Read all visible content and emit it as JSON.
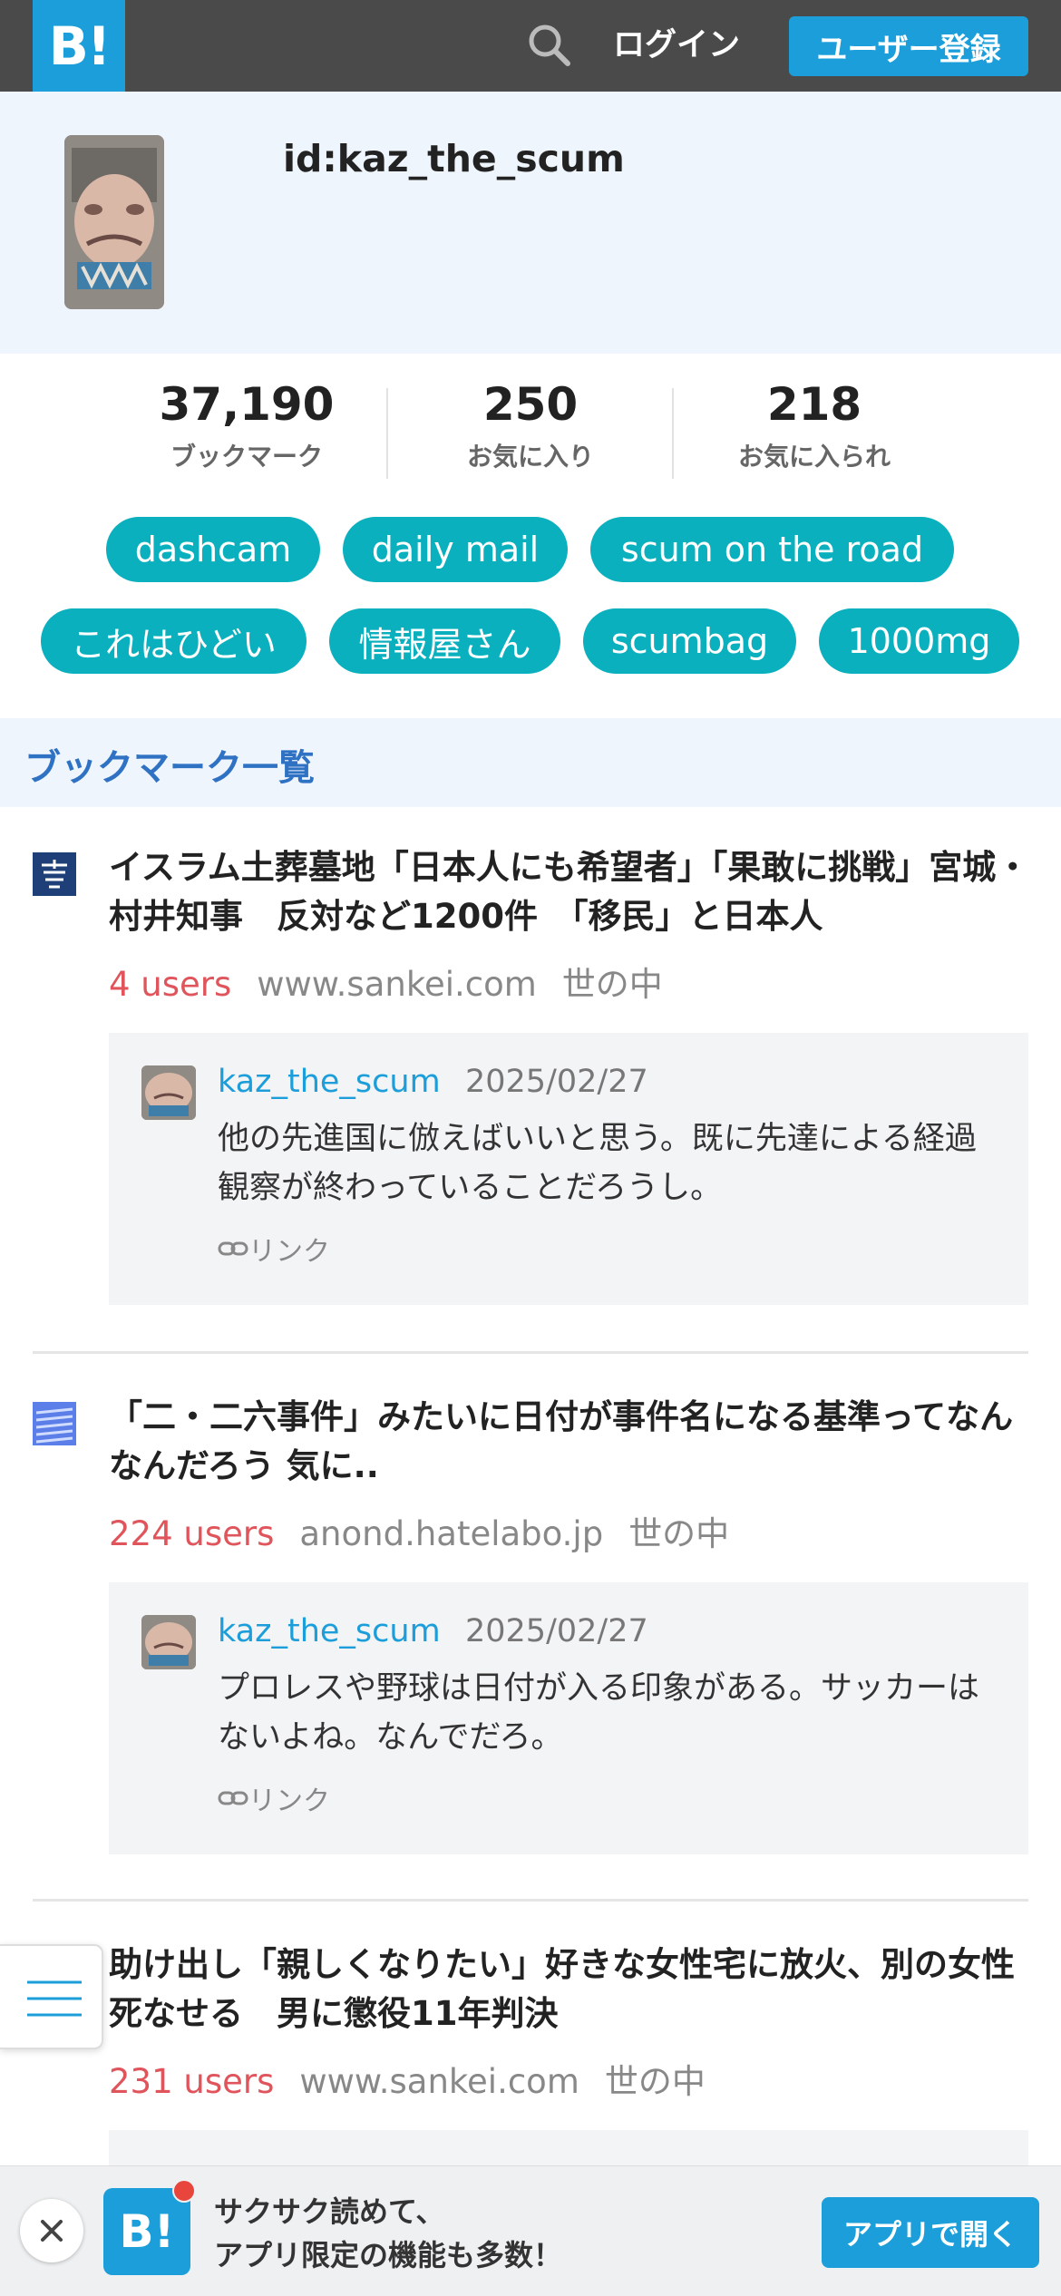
{
  "header": {
    "logo": "B!",
    "login_label": "ログイン",
    "register_label": "ユーザー登録"
  },
  "profile": {
    "username": "id:kaz_the_scum"
  },
  "stats": [
    {
      "value": "37,190",
      "label": "ブックマーク"
    },
    {
      "value": "250",
      "label": "お気に入り"
    },
    {
      "value": "218",
      "label": "お気に入られ"
    }
  ],
  "tags": [
    "dashcam",
    "daily mail",
    "scum on the road",
    "これはひどい",
    "情報屋さん",
    "scumbag",
    "1000mg"
  ],
  "section_title": "ブックマーク一覧",
  "entries": [
    {
      "title": "イスラム土葬墓地「日本人にも希望者」「果敢に挑戦」宮城・村井知事　反対など1200件　「移民」と日本人",
      "users": "4 users",
      "domain": "www.sankei.com",
      "category": "世の中",
      "comment": {
        "user": "kaz_the_scum",
        "date": "2025/02/27",
        "text": "他の先進国に倣えばいいと思う。既に先達による経過観察が終わっていることだろうし。",
        "link_label": "リンク"
      }
    },
    {
      "title": "「二・二六事件」みたいに日付が事件名になる基準ってなんなんだろう 気に..",
      "users": "224 users",
      "domain": "anond.hatelabo.jp",
      "category": "世の中",
      "comment": {
        "user": "kaz_the_scum",
        "date": "2025/02/27",
        "text": "プロレスや野球は日付が入る印象がある。サッカーはないよね。なんでだろ。",
        "link_label": "リンク"
      }
    },
    {
      "title": "助け出し「親しくなりたい」好きな女性宅に放火、別の女性死なせる　男に懲役11年判決",
      "users": "231 users",
      "domain": "www.sankei.com",
      "category": "世の中"
    }
  ],
  "banner": {
    "app_icon": "B!",
    "line1": "サクサク読めて、",
    "line2": "アプリ限定の機能も多数！",
    "open_label": "アプリで開く"
  },
  "colors": {
    "brand": "#1b9ed9",
    "tag": "#0ab0bd",
    "users": "#e0545c",
    "section": "#2f72c4"
  }
}
